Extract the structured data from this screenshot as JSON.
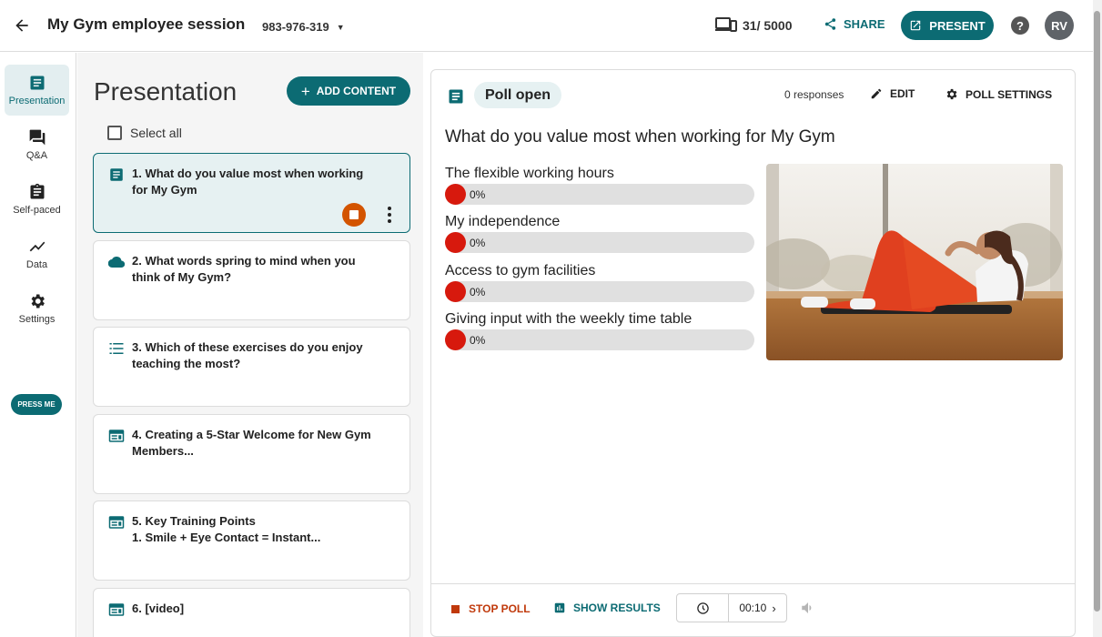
{
  "header": {
    "title": "My Gym employee session",
    "session_code": "983-976-319",
    "devices_count": "31/ 5000",
    "share_label": "SHARE",
    "present_label": "PRESENT",
    "help_label": "?",
    "avatar_initials": "RV"
  },
  "rail": {
    "items": [
      {
        "label": "Presentation",
        "icon": "presentation-icon",
        "active": true
      },
      {
        "label": "Q&A",
        "icon": "chat-icon"
      },
      {
        "label": "Self-paced",
        "icon": "clipboard-icon"
      },
      {
        "label": "Data",
        "icon": "chart-line-icon"
      },
      {
        "label": "Settings",
        "icon": "gear-icon"
      }
    ],
    "press_me_label": "PRESS ME"
  },
  "content": {
    "title": "Presentation",
    "add_content_label": "ADD CONTENT",
    "select_all_label": "Select all",
    "cards": [
      {
        "title": "1. What do you value most when working\nfor My Gym",
        "icon": "poll-icon",
        "active": true
      },
      {
        "title": "2. What words spring to mind when you\nthink of My Gym?",
        "icon": "cloud-icon"
      },
      {
        "title": "3. Which of these exercises do you enjoy\nteaching the most?",
        "icon": "list-icon"
      },
      {
        "title": "4. Creating a 5-Star Welcome for New Gym\nMembers...",
        "icon": "slide-icon"
      },
      {
        "title": "5. Key Training Points\n1. Smile + Eye Contact = Instant...",
        "icon": "slide-icon"
      },
      {
        "title": "6. [video]",
        "icon": "slide-icon"
      }
    ]
  },
  "poll": {
    "status": "Poll open",
    "responses": "0 responses",
    "edit_label": "EDIT",
    "settings_label": "POLL SETTINGS",
    "question": "What do you value most when working for My Gym",
    "options": [
      {
        "label": "The flexible working hours",
        "percent_label": "0%",
        "percent": 0
      },
      {
        "label": "My independence",
        "percent_label": "0%",
        "percent": 0
      },
      {
        "label": "Access to gym facilities",
        "percent_label": "0%",
        "percent": 0
      },
      {
        "label": "Giving input with the weekly time table",
        "percent_label": "0%",
        "percent": 0
      }
    ],
    "image_alt": "woman-doing-crunches-photo"
  },
  "controls": {
    "stop_poll_label": "STOP POLL",
    "show_results_label": "SHOW RESULTS",
    "timer_value": "00:10"
  },
  "colors": {
    "brand": "#0c6b73",
    "stop": "#c0390b",
    "bar_fill": "#d7190d"
  }
}
